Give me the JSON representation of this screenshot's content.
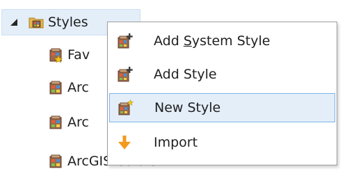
{
  "tree": {
    "root": {
      "label": "Styles",
      "expanded": true
    },
    "children": [
      {
        "label": "Fav",
        "icon": "favorites-style-icon"
      },
      {
        "label": "Arc",
        "icon": "style-icon"
      },
      {
        "label": "Arc",
        "icon": "style-icon"
      },
      {
        "label": "ArcGIS Colors",
        "icon": "style-icon"
      }
    ]
  },
  "context_menu": {
    "items": [
      {
        "before": "Add ",
        "key": "S",
        "after": "ystem Style",
        "icon": "add-style-icon"
      },
      {
        "label": "Add Style",
        "icon": "add-style-icon"
      },
      {
        "label": "New Style",
        "icon": "new-style-icon",
        "highlighted": true
      },
      {
        "label": "Import",
        "icon": "import-arrow-icon"
      }
    ]
  },
  "colors": {
    "selection_fill": "#e3eef9",
    "selection_border": "#7eb4ea",
    "menu_border": "#9d9d9d",
    "import_arrow": "#f39a1e"
  }
}
